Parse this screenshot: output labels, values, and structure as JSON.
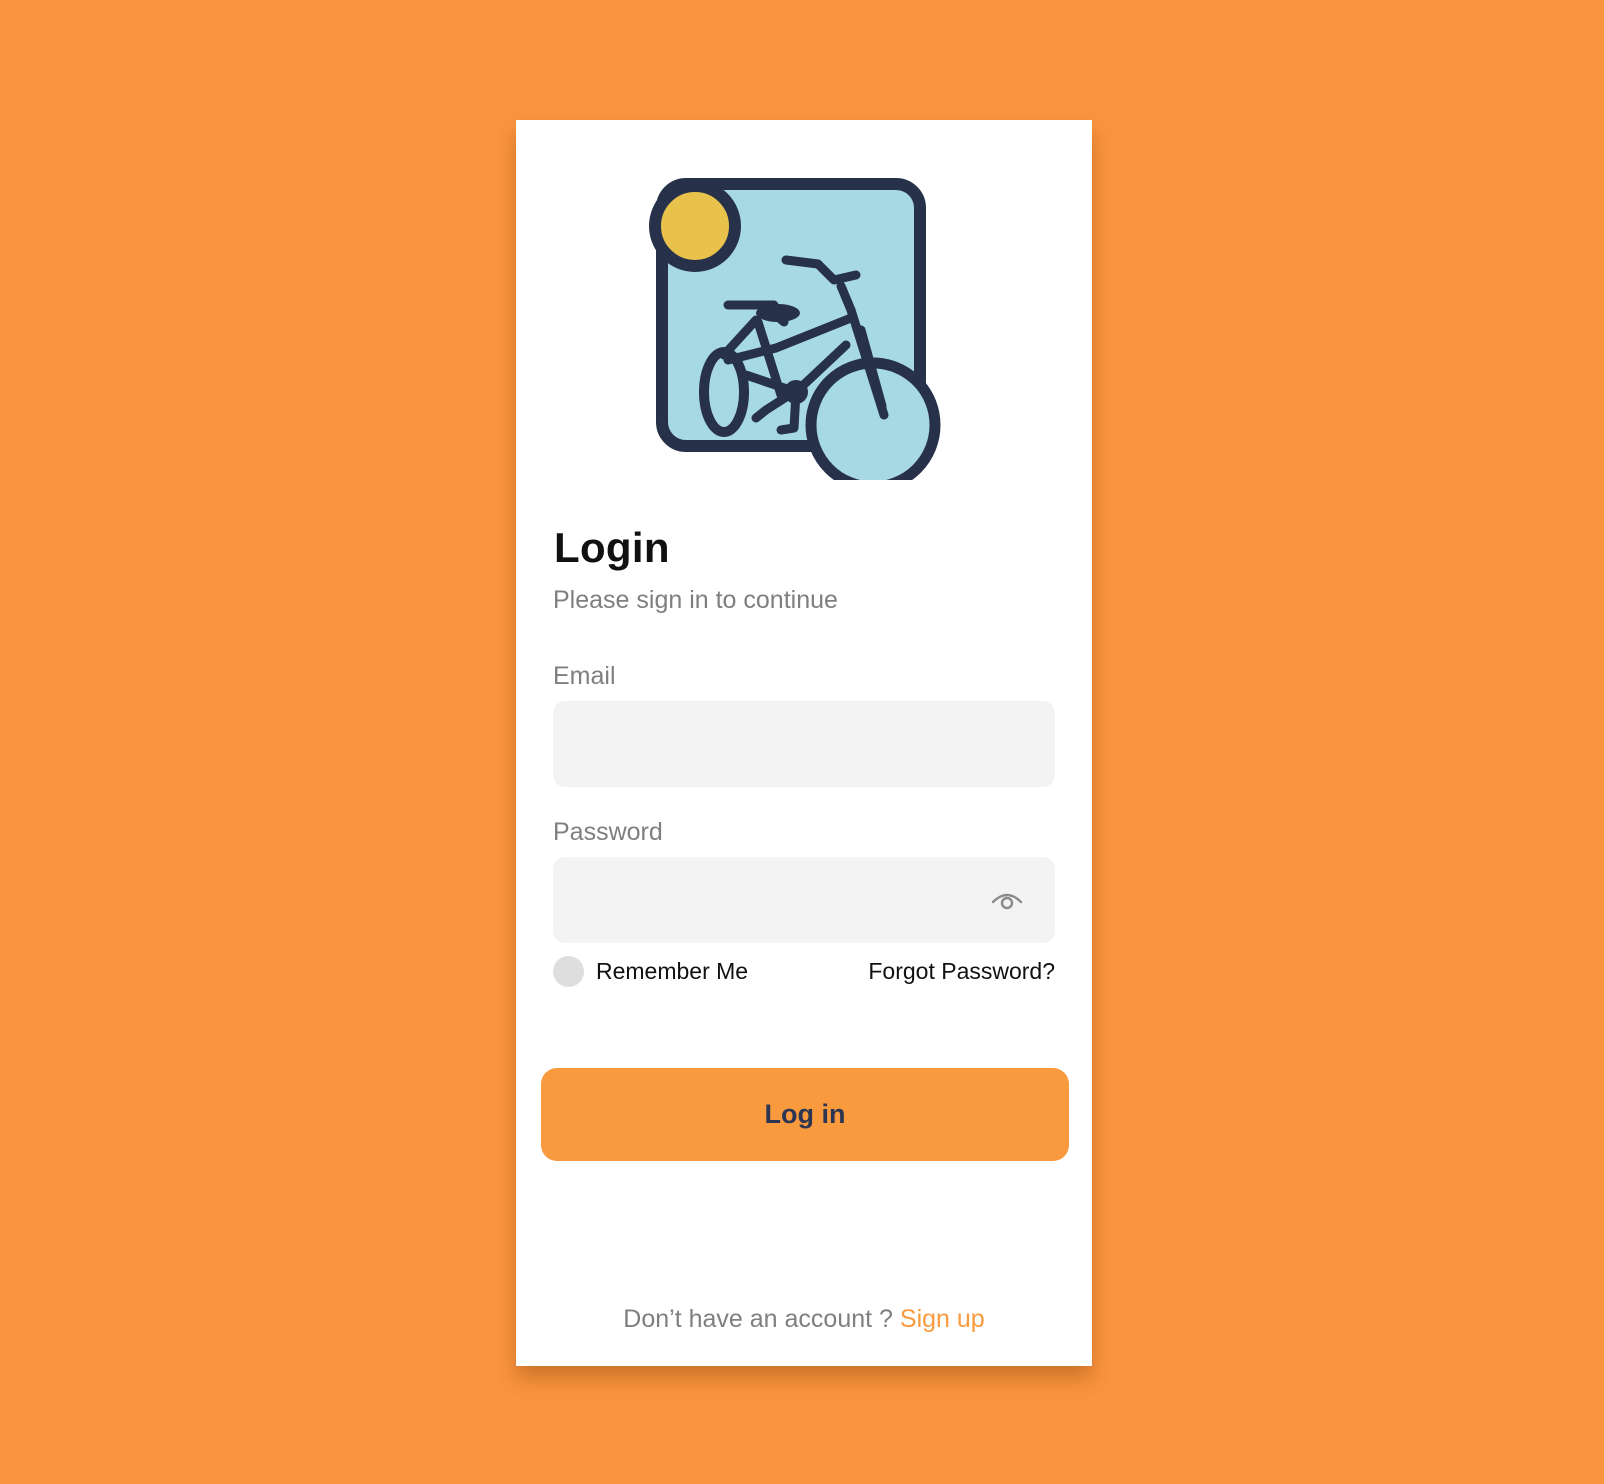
{
  "logo": {
    "icon": "bicycle-logo-icon"
  },
  "header": {
    "title": "Login",
    "subtitle": "Please sign in to continue"
  },
  "form": {
    "email_label": "Email",
    "email_value": "",
    "password_label": "Password",
    "password_value": "",
    "remember_label": "Remember Me",
    "remember_checked": false,
    "forgot_label": "Forgot Password?",
    "submit_label": "Log in"
  },
  "footer": {
    "prompt": "Don’t have an account ?",
    "signup_label": "Sign up"
  },
  "colors": {
    "background": "#fa943e",
    "accent": "#f99a3f",
    "button_text": "#2c3652",
    "muted_text": "#7f7f7f",
    "input_bg": "#f3f3f3"
  }
}
